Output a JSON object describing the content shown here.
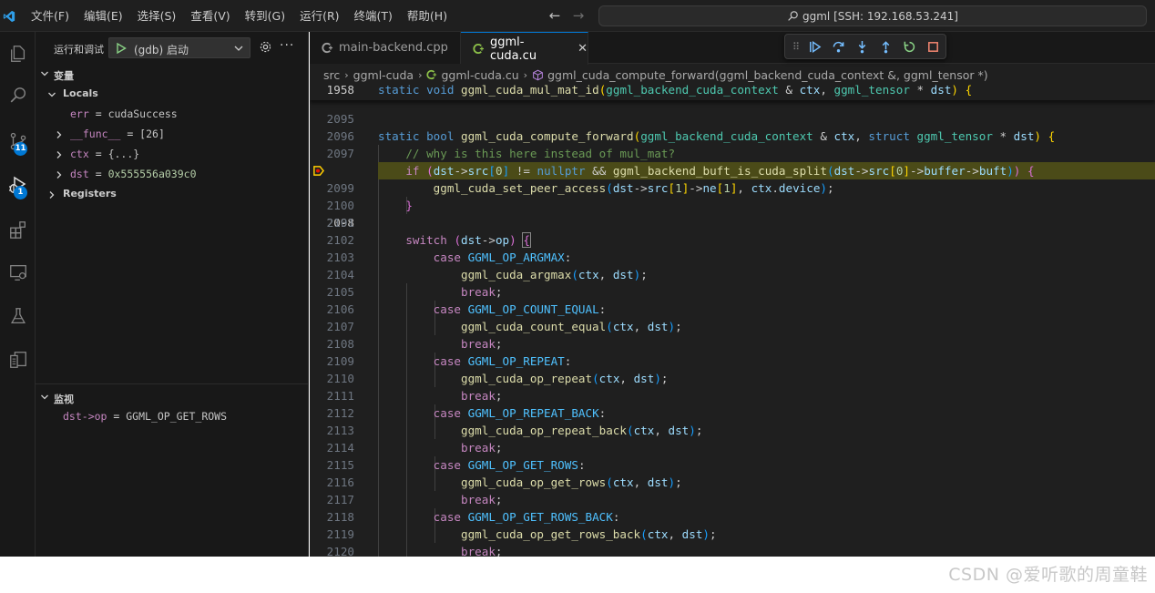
{
  "titlebar": {
    "menu": [
      "文件(F)",
      "编辑(E)",
      "选择(S)",
      "查看(V)",
      "转到(G)",
      "运行(R)",
      "终端(T)",
      "帮助(H)"
    ],
    "search_text": "ggml [SSH: 192.168.53.241]"
  },
  "activitybar": {
    "items": [
      "explorer-icon",
      "search-icon",
      "source-control-icon",
      "run-debug-icon",
      "extensions-icon",
      "remote-explorer-icon",
      "testing-icon",
      "remote-icon"
    ],
    "source_control_badge": "11",
    "debug_badge": "1"
  },
  "sidebar": {
    "title": "运行和调试",
    "config": "(gdb) 启动",
    "variables_title": "变量",
    "locals_label": "Locals",
    "registers_label": "Registers",
    "vars": [
      {
        "name": "err",
        "eq": " = ",
        "value": "cudaSuccess"
      },
      {
        "name": "__func__",
        "eq": " = ",
        "value": "[26]"
      },
      {
        "name": "ctx",
        "eq": " = ",
        "value": "{...}"
      },
      {
        "name": "dst",
        "eq": " = ",
        "value": "0x555556a039c0"
      }
    ],
    "watch_title": "监视",
    "watch": [
      {
        "expr": "dst->op",
        "eq": " = ",
        "value": "GGML_OP_GET_ROWS"
      }
    ]
  },
  "editor": {
    "tabs": [
      {
        "label": "main-backend.cpp",
        "active": false
      },
      {
        "label": "ggml-cuda.cu",
        "active": true
      }
    ],
    "breadcrumb": [
      "src",
      "ggml-cuda",
      "ggml-cuda.cu",
      "ggml_cuda_compute_forward(ggml_backend_cuda_context &, ggml_tensor *)"
    ],
    "sticky_line_no": "1958",
    "current_line": "2098",
    "line_numbers": [
      "2095",
      "2096",
      "2097",
      "2098",
      "2099",
      "2100",
      "2101",
      "2102",
      "2103",
      "2104",
      "2105",
      "2106",
      "2107",
      "2108",
      "2109",
      "2110",
      "2111",
      "2112",
      "2113",
      "2114",
      "2115",
      "2116",
      "2117",
      "2118",
      "2119",
      "2120"
    ],
    "cases": [
      {
        "op": "GGML_OP_ARGMAX",
        "fn": "ggml_cuda_argmax"
      },
      {
        "op": "GGML_OP_COUNT_EQUAL",
        "fn": "ggml_cuda_count_equal"
      },
      {
        "op": "GGML_OP_REPEAT",
        "fn": "ggml_cuda_op_repeat"
      },
      {
        "op": "GGML_OP_REPEAT_BACK",
        "fn": "ggml_cuda_op_repeat_back"
      },
      {
        "op": "GGML_OP_GET_ROWS",
        "fn": "ggml_cuda_op_get_rows"
      },
      {
        "op": "GGML_OP_GET_ROWS_BACK",
        "fn": "ggml_cuda_op_get_rows_back"
      }
    ],
    "comment": "// why is this here instead of mul_mat?"
  },
  "watermark": "CSDN @爱听歌的周童鞋"
}
